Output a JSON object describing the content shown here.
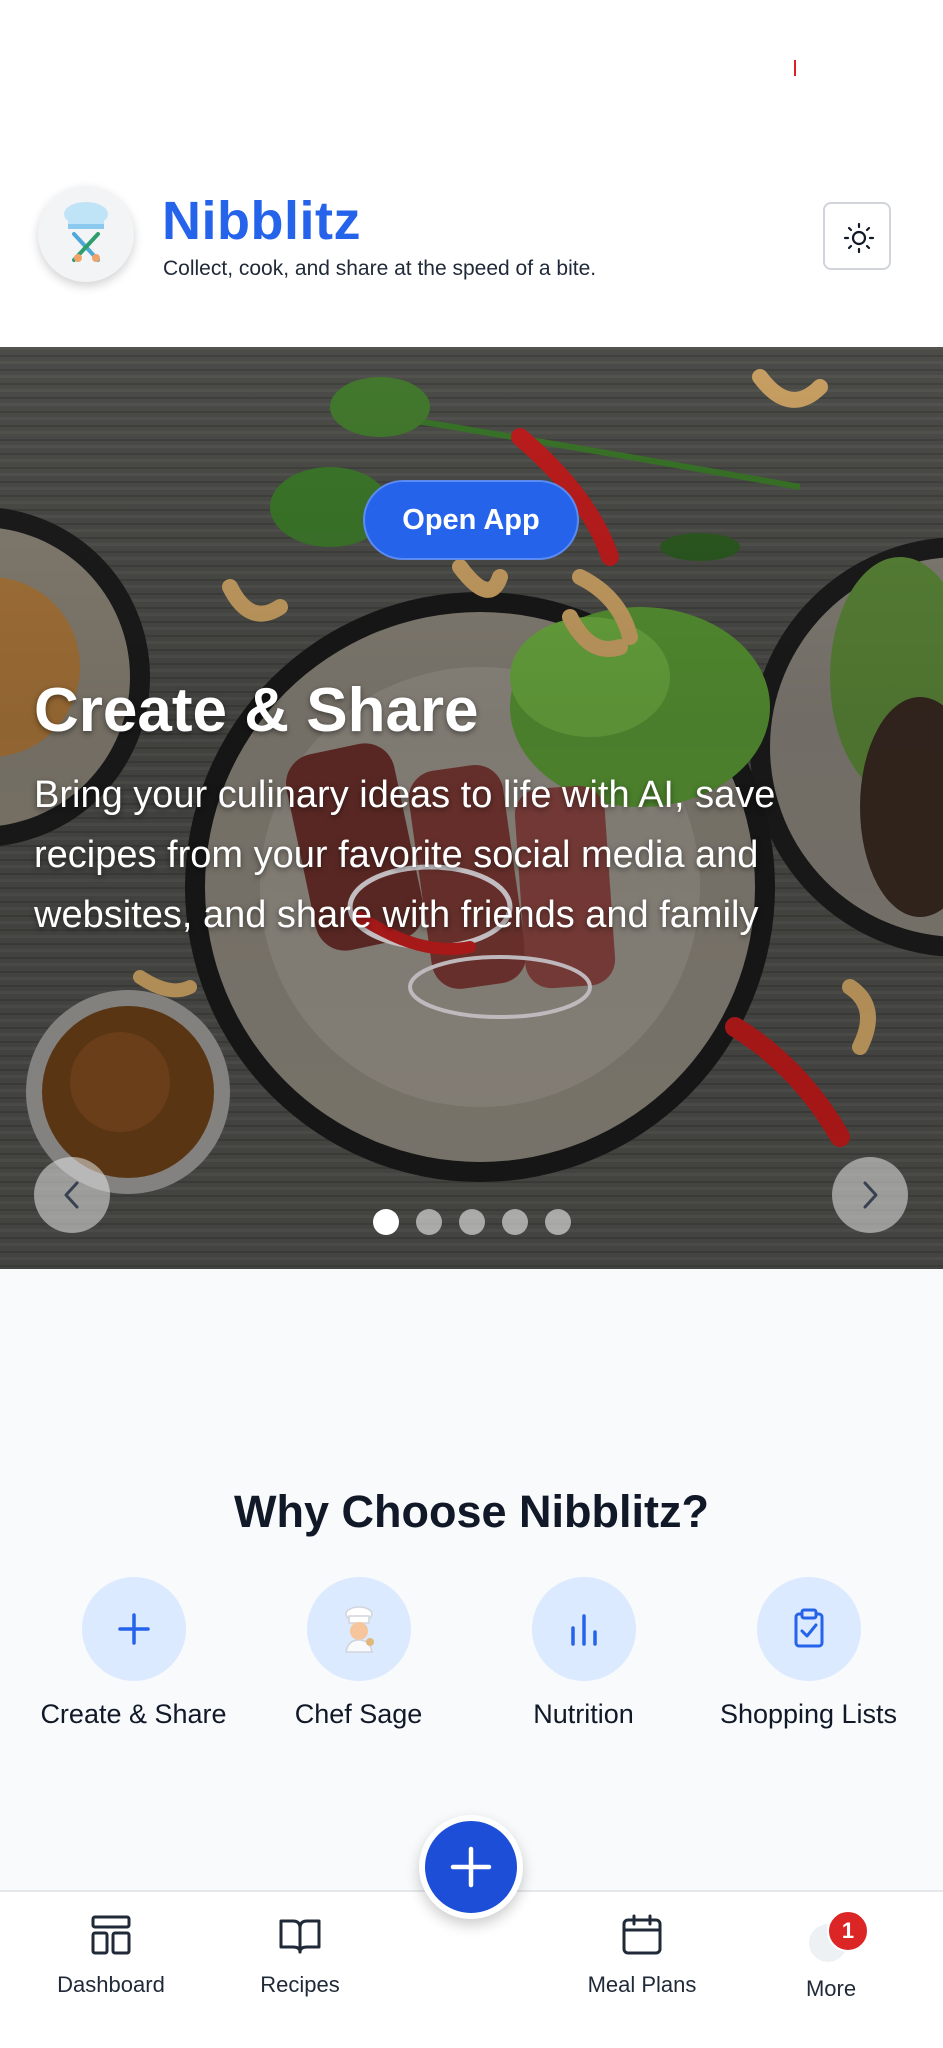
{
  "header": {
    "app_name": "Nibblitz",
    "tagline": "Collect, cook, and share at the speed of a bite.",
    "theme_toggle_icon": "sun-icon"
  },
  "hero": {
    "open_app_label": "Open App",
    "slide_title": "Create & Share",
    "slide_description": "Bring your culinary ideas to life with AI, save recipes from your favorite social media and websites, and share with friends and family",
    "slide_count": 5,
    "active_slide": 1,
    "prev_icon": "chevron-left-icon",
    "next_icon": "chevron-right-icon"
  },
  "features": {
    "title": "Why Choose Nibblitz?",
    "items": [
      {
        "label": "Create & Share",
        "icon": "plus-icon"
      },
      {
        "label": "Chef Sage",
        "icon": "chef-icon"
      },
      {
        "label": "Nutrition",
        "icon": "bar-chart-icon"
      },
      {
        "label": "Shopping Lists",
        "icon": "clipboard-check-icon"
      }
    ]
  },
  "bottom_nav": {
    "items": [
      {
        "label": "Dashboard",
        "icon": "dashboard-icon"
      },
      {
        "label": "Recipes",
        "icon": "book-icon"
      },
      {
        "label": "Meal Plans",
        "icon": "calendar-icon"
      },
      {
        "label": "More",
        "icon": "avatar-icon"
      }
    ],
    "more_badge": "1",
    "fab_icon": "plus-icon"
  },
  "colors": {
    "brand": "#2563eb",
    "feature_circle": "#dbeafe",
    "badge": "#dc2626"
  }
}
